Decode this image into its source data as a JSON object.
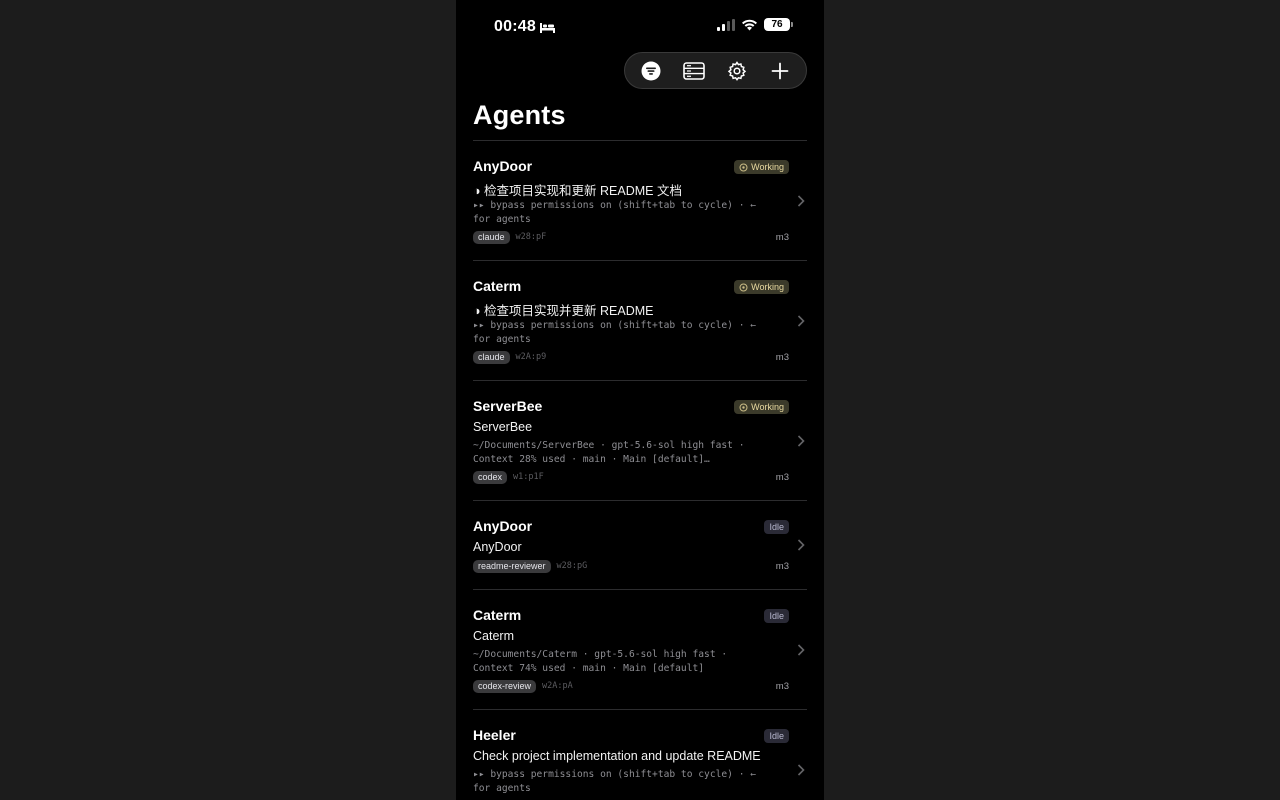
{
  "status_bar": {
    "time": "00:48",
    "battery": "76"
  },
  "toolbar": {
    "buttons": [
      "list-filter-icon",
      "servers-icon",
      "gear-icon",
      "plus-icon"
    ]
  },
  "page": {
    "title": "Agents"
  },
  "agents": [
    {
      "name": "AnyDoor",
      "status": "Working",
      "subtitle": "◑ 检查项目实现和更新 README 文档",
      "detail": "▸▸ bypass permissions on (shift+tab to cycle) · ←\nfor agents",
      "tag": "claude",
      "id": "w28:pF",
      "host": "m3"
    },
    {
      "name": "Caterm",
      "status": "Working",
      "subtitle": "◑ 检查项目实现并更新 README",
      "detail": "▸▸ bypass permissions on (shift+tab to cycle) · ←\nfor agents",
      "tag": "claude",
      "id": "w2A:p9",
      "host": "m3"
    },
    {
      "name": "ServerBee",
      "status": "Working",
      "subtitle": "ServerBee",
      "detail": "~/Documents/ServerBee · gpt-5.6-sol high fast ·\nContext 28% used · main · Main [default]…",
      "tag": "codex",
      "id": "w1:p1F",
      "host": "m3"
    },
    {
      "name": "AnyDoor",
      "status": "Idle",
      "subtitle": "AnyDoor",
      "detail": "",
      "tag": "readme-reviewer",
      "id": "w28:pG",
      "host": "m3"
    },
    {
      "name": "Caterm",
      "status": "Idle",
      "subtitle": "Caterm",
      "detail": "~/Documents/Caterm · gpt-5.6-sol high fast ·\nContext 74% used · main · Main [default]",
      "tag": "codex-review",
      "id": "w2A:pA",
      "host": "m3"
    },
    {
      "name": "Heeler",
      "status": "Idle",
      "subtitle": "Check project implementation and update README",
      "detail": "▸▸ bypass permissions on (shift+tab to cycle) · ←\nfor agents",
      "tag": "",
      "id": "",
      "host": ""
    }
  ],
  "colors": {
    "working_badge": "#3b3a2a",
    "idle_badge": "#2a2a36",
    "background": "#000000"
  }
}
